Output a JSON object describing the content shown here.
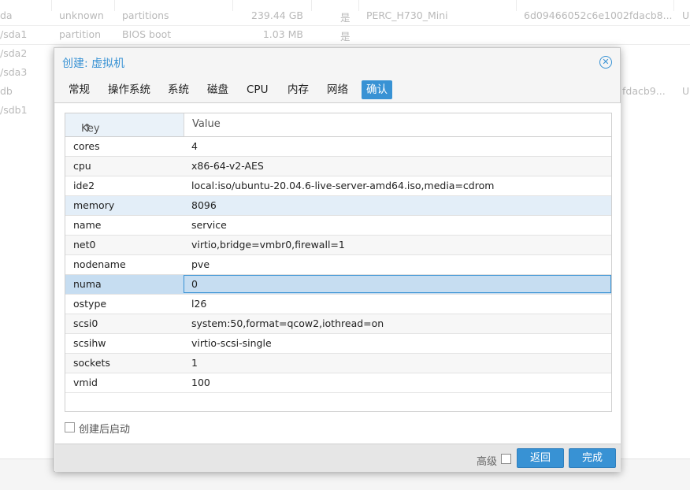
{
  "background": {
    "rows": [
      {
        "device": "da",
        "type": "unknown",
        "usage": "partitions",
        "size": "239.44 GB",
        "gpt": "是",
        "model": "PERC_H730_Mini",
        "serial": "6d09466052c6e1002fdacb8...",
        "s": "U"
      },
      {
        "device": "/sda1",
        "type": "partition",
        "usage": "BIOS boot",
        "size": "1.03 MB",
        "gpt": "是",
        "model": "",
        "serial": "",
        "s": ""
      },
      {
        "device": "/sda2",
        "type": "",
        "usage": "",
        "size": "",
        "gpt": "",
        "model": "",
        "serial": "",
        "s": ""
      },
      {
        "device": "/sda3",
        "type": "",
        "usage": "",
        "size": "",
        "gpt": "",
        "model": "",
        "serial": "",
        "s": ""
      },
      {
        "device": "db",
        "type": "",
        "usage": "",
        "size": "",
        "gpt": "",
        "model": "",
        "serial": "fdacb9...",
        "s": "U"
      },
      {
        "device": "/sdb1",
        "type": "",
        "usage": "",
        "size": "",
        "gpt": "",
        "model": "",
        "serial": "",
        "s": ""
      }
    ]
  },
  "dialog": {
    "title": "创建: 虚拟机",
    "close_icon": "close-circle-icon",
    "tabs": [
      {
        "label": "常规"
      },
      {
        "label": "操作系统"
      },
      {
        "label": "系统"
      },
      {
        "label": "磁盘"
      },
      {
        "label": "CPU"
      },
      {
        "label": "内存"
      },
      {
        "label": "网络"
      },
      {
        "label": "确认",
        "active": true
      }
    ],
    "grid": {
      "key_header": "Key",
      "sort_icon": "↑",
      "value_header": "Value",
      "rows": [
        {
          "key": "cores",
          "value": "4"
        },
        {
          "key": "cpu",
          "value": "x86-64-v2-AES"
        },
        {
          "key": "ide2",
          "value": "local:iso/ubuntu-20.04.6-live-server-amd64.iso,media=cdrom"
        },
        {
          "key": "memory",
          "value": "8096"
        },
        {
          "key": "name",
          "value": "service"
        },
        {
          "key": "net0",
          "value": "virtio,bridge=vmbr0,firewall=1"
        },
        {
          "key": "nodename",
          "value": "pve"
        },
        {
          "key": "numa",
          "value": "0"
        },
        {
          "key": "ostype",
          "value": "l26"
        },
        {
          "key": "scsi0",
          "value": "system:50,format=qcow2,iothread=on"
        },
        {
          "key": "scsihw",
          "value": "virtio-scsi-single"
        },
        {
          "key": "sockets",
          "value": "1"
        },
        {
          "key": "vmid",
          "value": "100"
        }
      ]
    },
    "start_after_create_label": "创建后启动",
    "advanced_label": "高级",
    "back_label": "返回",
    "finish_label": "完成",
    "accent_color": "#3892d4"
  }
}
